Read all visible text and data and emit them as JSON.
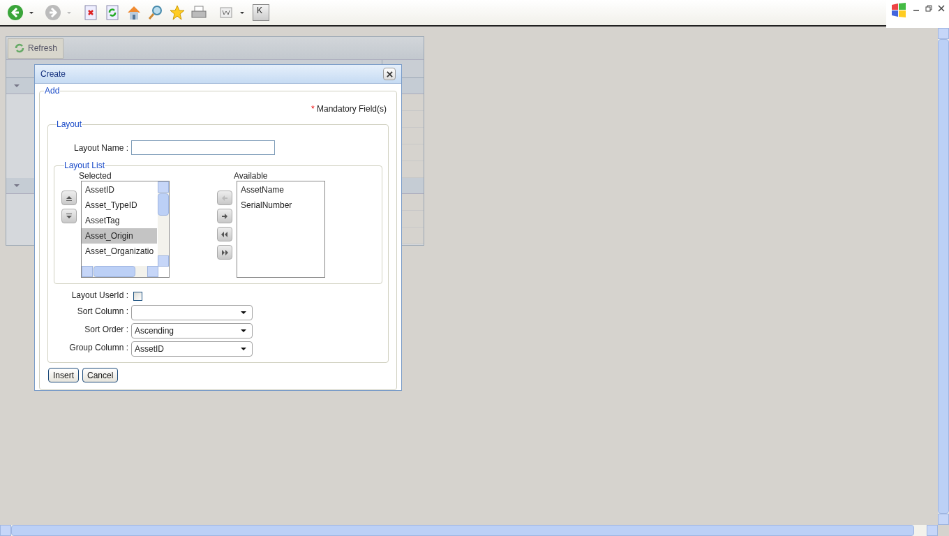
{
  "browser_toolbar": {
    "key_label": "K"
  },
  "grid": {
    "refresh_button": "Refresh"
  },
  "dialog": {
    "title": "Create",
    "add_legend": "Add",
    "required_mark": "*",
    "mandatory_note": "Mandatory Field(s)",
    "layout_legend": "Layout",
    "layout_name_label": "Layout Name :",
    "layout_list": {
      "legend": "Layout List",
      "selected_heading": "Selected",
      "available_heading": "Available",
      "selected_items": [
        {
          "text": "AssetID",
          "selected": false
        },
        {
          "text": "Asset_TypeID",
          "selected": false
        },
        {
          "text": "AssetTag",
          "selected": false
        },
        {
          "text": "Asset_Origin",
          "selected": true
        },
        {
          "text": "Asset_Organizatio",
          "selected": false
        }
      ],
      "available_items": [
        "AssetName",
        "SerialNumber"
      ]
    },
    "layout_userid": {
      "label": "Layout UserId :",
      "checked": false
    },
    "selects": [
      {
        "label": "Sort Column :"
      },
      {
        "label": "Sort Order :",
        "value": "Ascending"
      },
      {
        "label": "Group Column :",
        "value": "AssetID"
      }
    ],
    "buttons": [
      "Insert",
      "Cancel"
    ]
  }
}
